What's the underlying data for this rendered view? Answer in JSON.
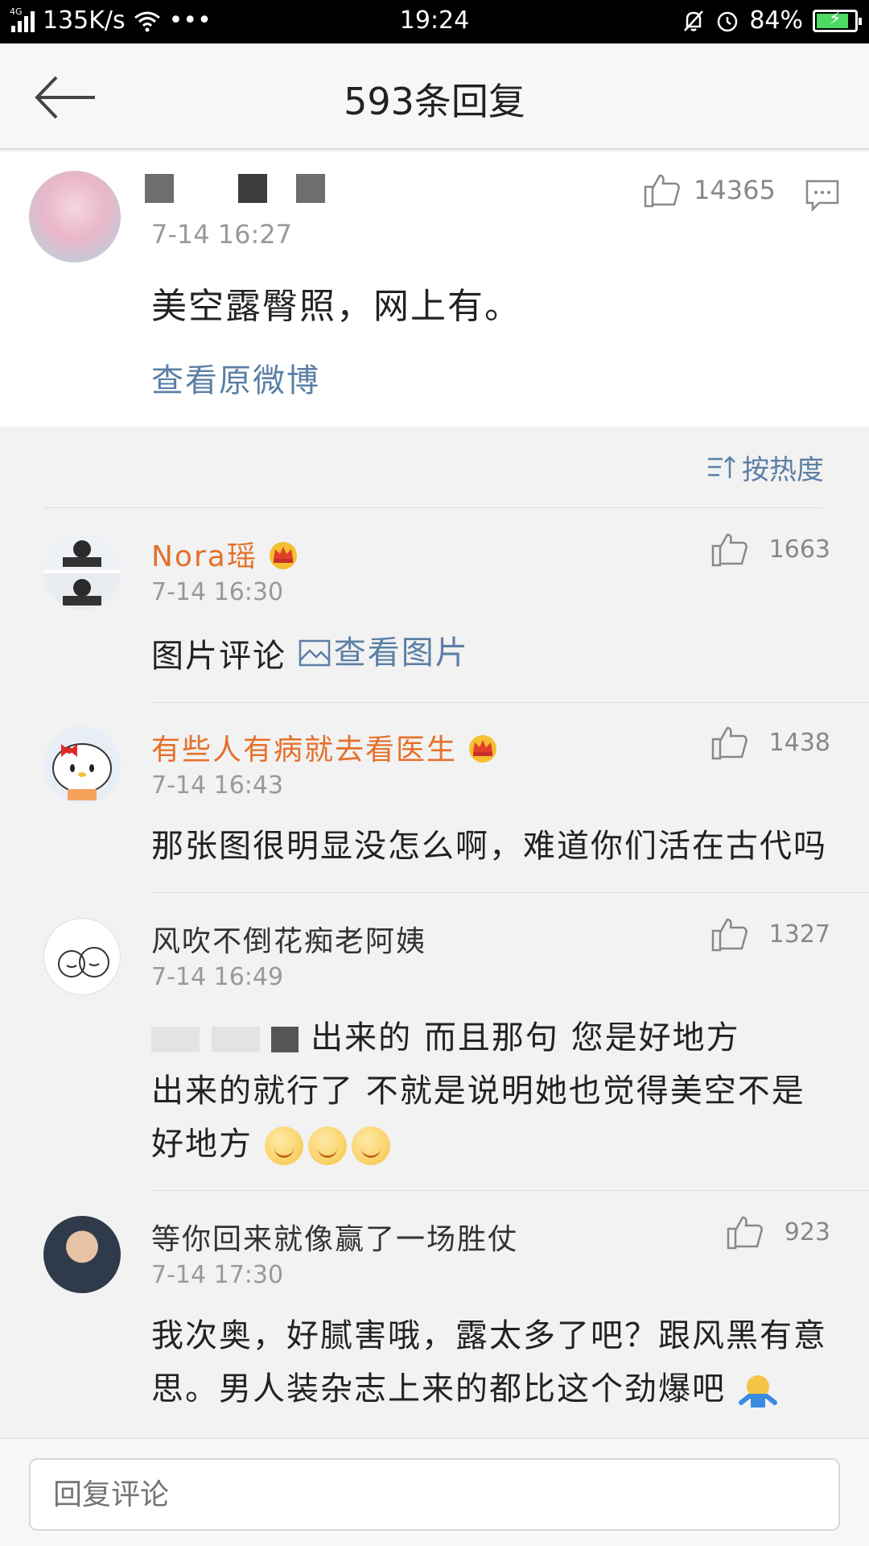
{
  "status_bar": {
    "network": "4G",
    "speed": "135K/s",
    "dots": "•••",
    "time": "19:24",
    "battery": "84%",
    "battery_level": 0.84
  },
  "header": {
    "title": "593条回复"
  },
  "post": {
    "date": "7-14 16:27",
    "likes": "14365",
    "text": "美空露臀照，网上有。",
    "link": "查看原微博"
  },
  "sort": {
    "label": "按热度"
  },
  "comments": [
    {
      "name": "Nora瑶",
      "vip": true,
      "date": "7-14 16:30",
      "likes": "1663",
      "text_prefix": "图片评论",
      "link": "查看图片"
    },
    {
      "name": "有些人有病就去看医生",
      "vip": true,
      "date": "7-14 16:43",
      "likes": "1438",
      "text": "那张图很明显没怎么啊，难道你们活在古代吗"
    },
    {
      "name": "风吹不倒花痴老阿姨",
      "vip": false,
      "date": "7-14 16:49",
      "likes": "1327",
      "text_line1": "出来的 而且那句 您是好地方",
      "text_line2": "出来的就行了 不就是说明她也觉得美空不是",
      "text_line3": "好地方"
    },
    {
      "name": "等你回来就像赢了一场胜仗",
      "vip": false,
      "date": "7-14 17:30",
      "likes": "923",
      "text": "我次奥，好腻害哦，露太多了吧？跟风黑有意思。男人装杂志上来的都比这个劲爆吧"
    }
  ],
  "reply_bar": {
    "placeholder": "回复评论"
  }
}
